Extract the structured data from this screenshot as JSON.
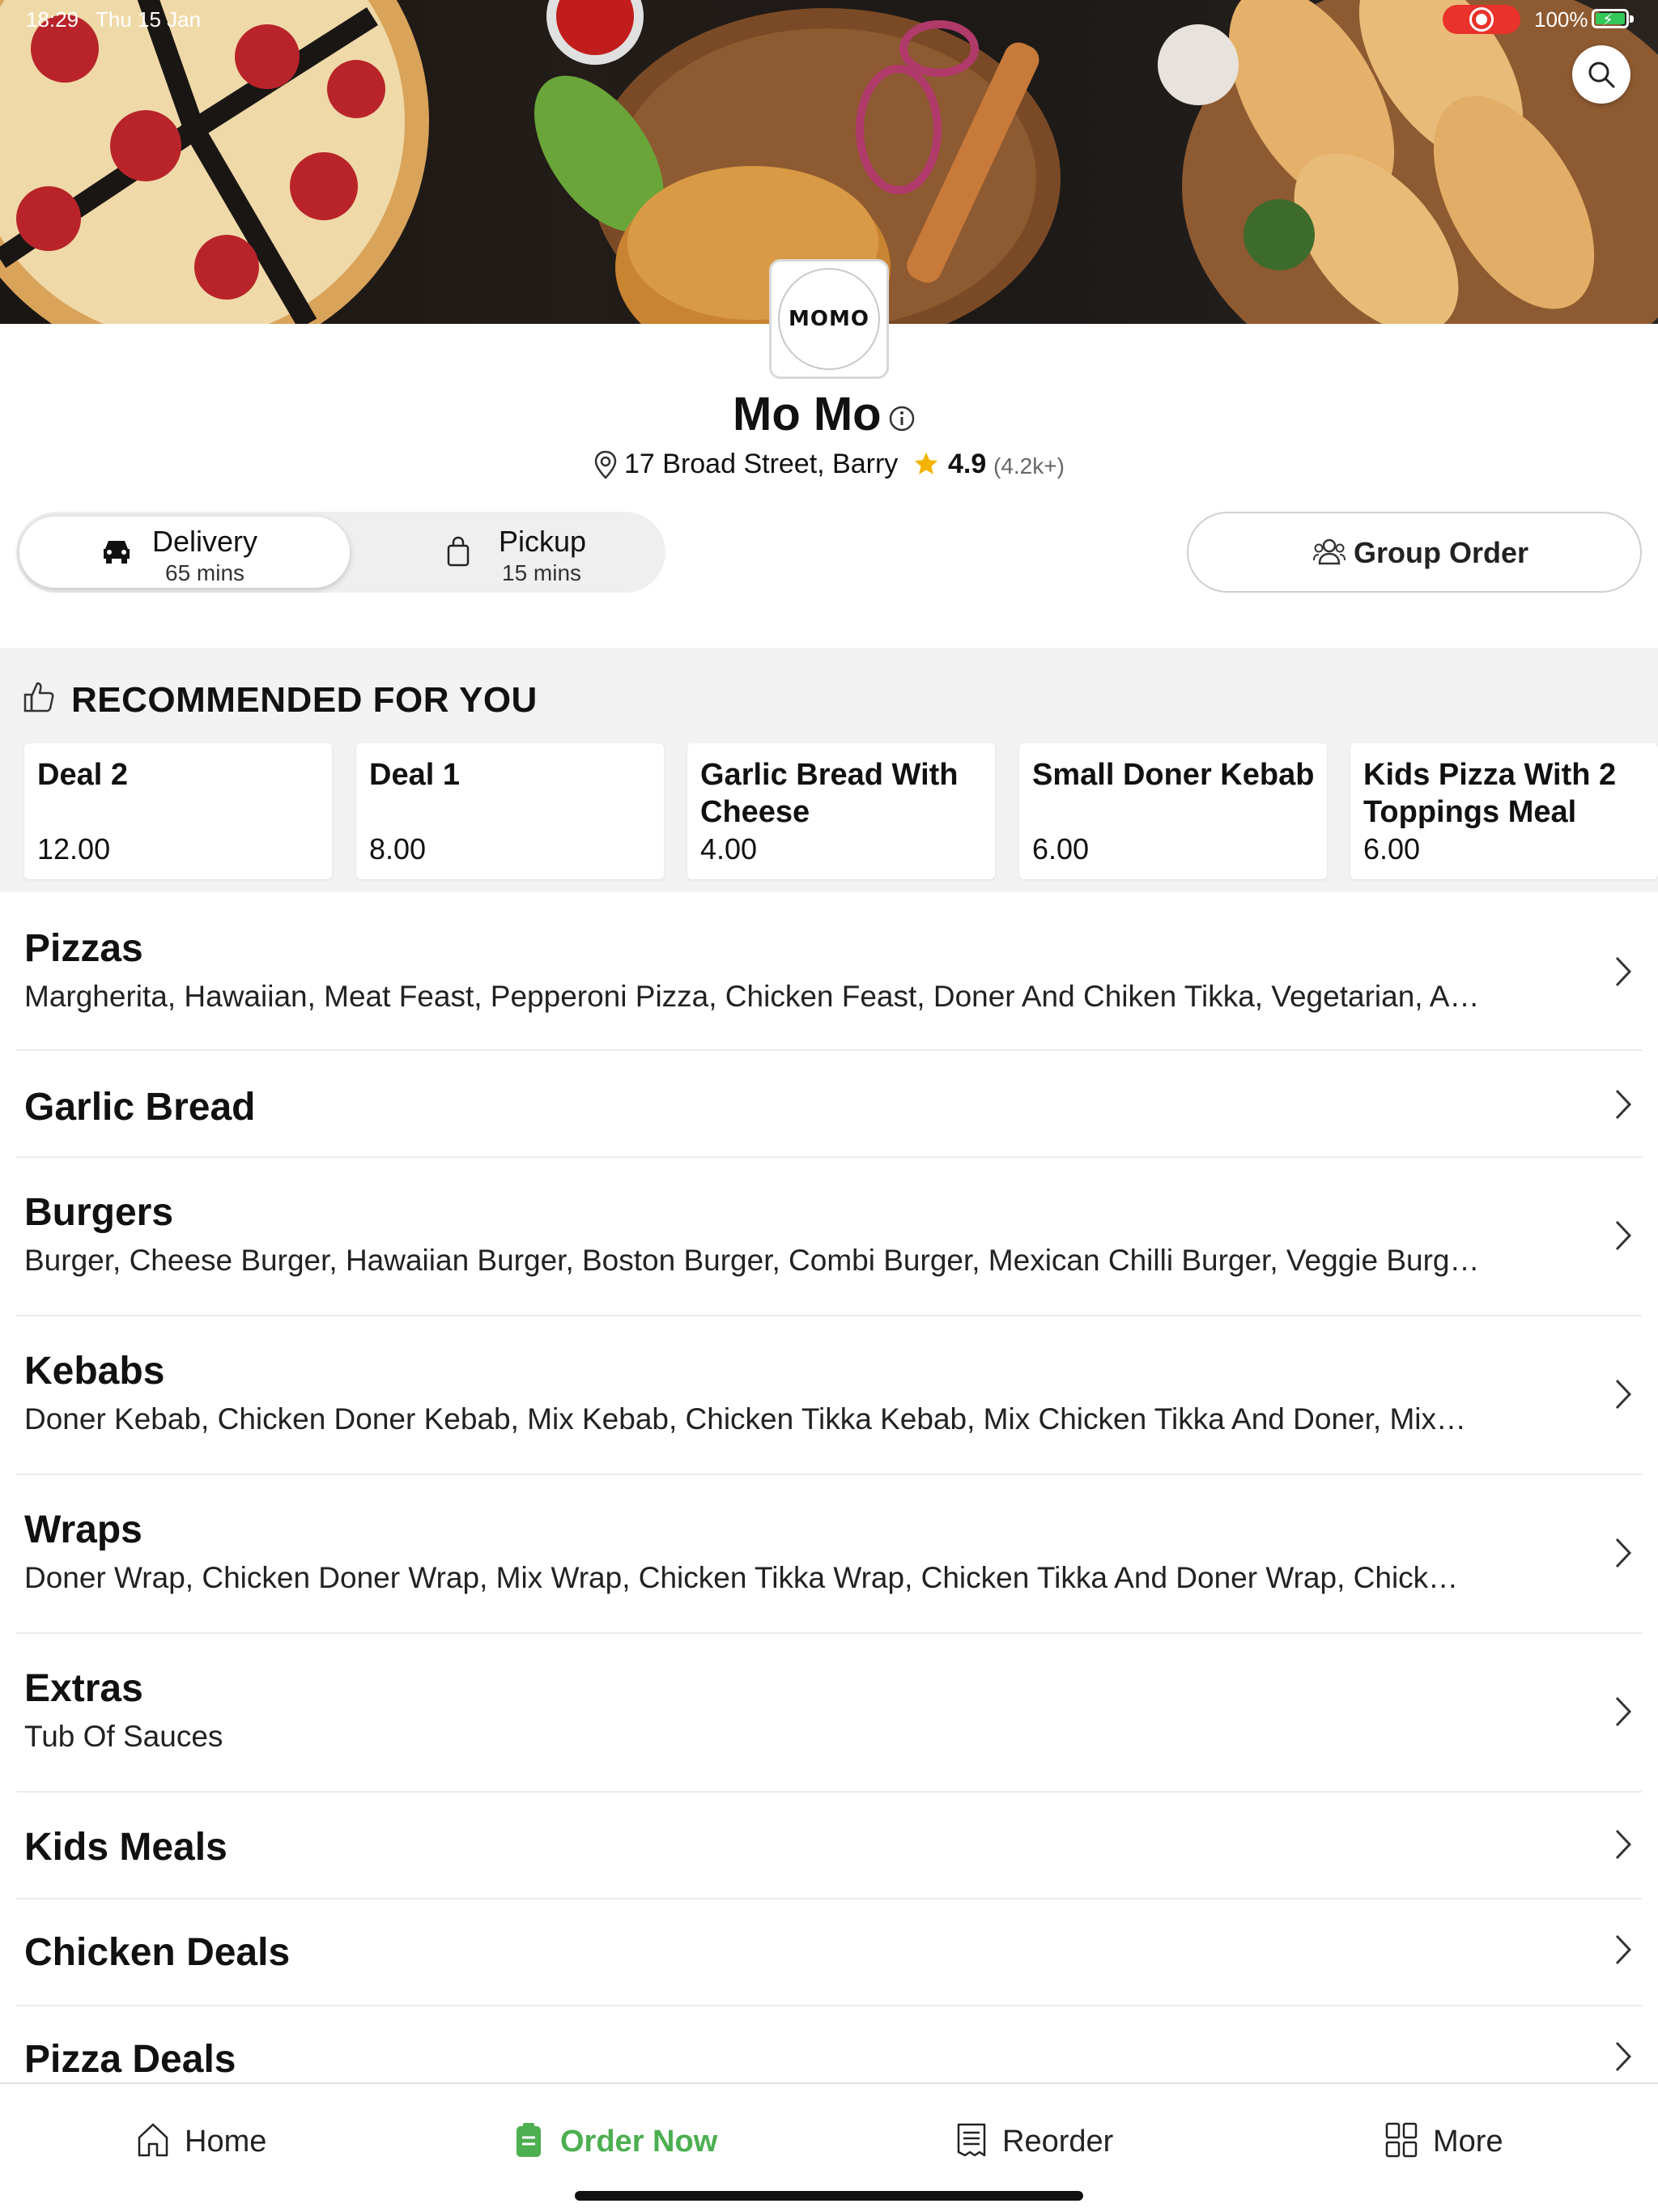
{
  "status_bar": {
    "time": "18:29",
    "date": "Thu 15 Jan",
    "battery": "100%"
  },
  "restaurant": {
    "logo_text": "MOMO",
    "name": "Mo Mo",
    "address": "17 Broad Street, Barry",
    "rating": "4.9",
    "rating_count": "(4.2k+)"
  },
  "fulfilment": {
    "delivery": {
      "label": "Delivery",
      "time": "65 mins"
    },
    "pickup": {
      "label": "Pickup",
      "time": "15 mins"
    },
    "selected": "delivery"
  },
  "group_order": {
    "label": "Group Order"
  },
  "recommended": {
    "title": "RECOMMENDED FOR YOU",
    "items": [
      {
        "name": "Deal 2",
        "price": "12.00"
      },
      {
        "name": "Deal 1",
        "price": "8.00"
      },
      {
        "name": "Garlic Bread With Cheese",
        "price": "4.00"
      },
      {
        "name": "Small Doner Kebab",
        "price": "6.00"
      },
      {
        "name": "Kids Pizza With 2 Toppings Meal",
        "price": "6.00"
      }
    ]
  },
  "categories": [
    {
      "title": "Pizzas",
      "items": "Margherita, Hawaiian, Meat Feast, Pepperoni Pizza, Chicken Feast, Doner And Chiken Tikka, Vegetarian, A…"
    },
    {
      "title": "Garlic Bread",
      "items": ""
    },
    {
      "title": "Burgers",
      "items": "Burger, Cheese Burger, Hawaiian Burger, Boston Burger, Combi Burger, Mexican Chilli Burger, Veggie Burg…"
    },
    {
      "title": "Kebabs",
      "items": "Doner Kebab, Chicken Doner Kebab, Mix Kebab, Chicken Tikka Kebab, Mix Chicken Tikka And Doner, Mix…"
    },
    {
      "title": "Wraps",
      "items": "Doner Wrap, Chicken Doner Wrap, Mix Wrap, Chicken Tikka Wrap, Chicken Tikka And Doner Wrap, Chick…"
    },
    {
      "title": "Extras",
      "items": "Tub Of Sauces"
    },
    {
      "title": "Kids Meals",
      "items": ""
    },
    {
      "title": "Chicken Deals",
      "items": ""
    },
    {
      "title": "Pizza Deals",
      "items": ""
    }
  ],
  "tab_bar": {
    "home": "Home",
    "order_now": "Order Now",
    "reorder": "Reorder",
    "more": "More",
    "active": "order_now"
  },
  "colors": {
    "accent_green": "#4caf50",
    "star": "#f5b301",
    "record_red": "#e8322b"
  },
  "icons": {
    "search": "search-icon",
    "info": "info-icon",
    "pin": "location-pin-icon",
    "star": "star-icon",
    "car": "car-icon",
    "bag": "shopping-bag-icon",
    "group": "group-icon",
    "thumbs_up": "thumbs-up-icon",
    "chevron": "chevron-right-icon",
    "home": "home-icon",
    "order": "order-icon",
    "receipt": "receipt-icon",
    "grid": "grid-icon"
  }
}
